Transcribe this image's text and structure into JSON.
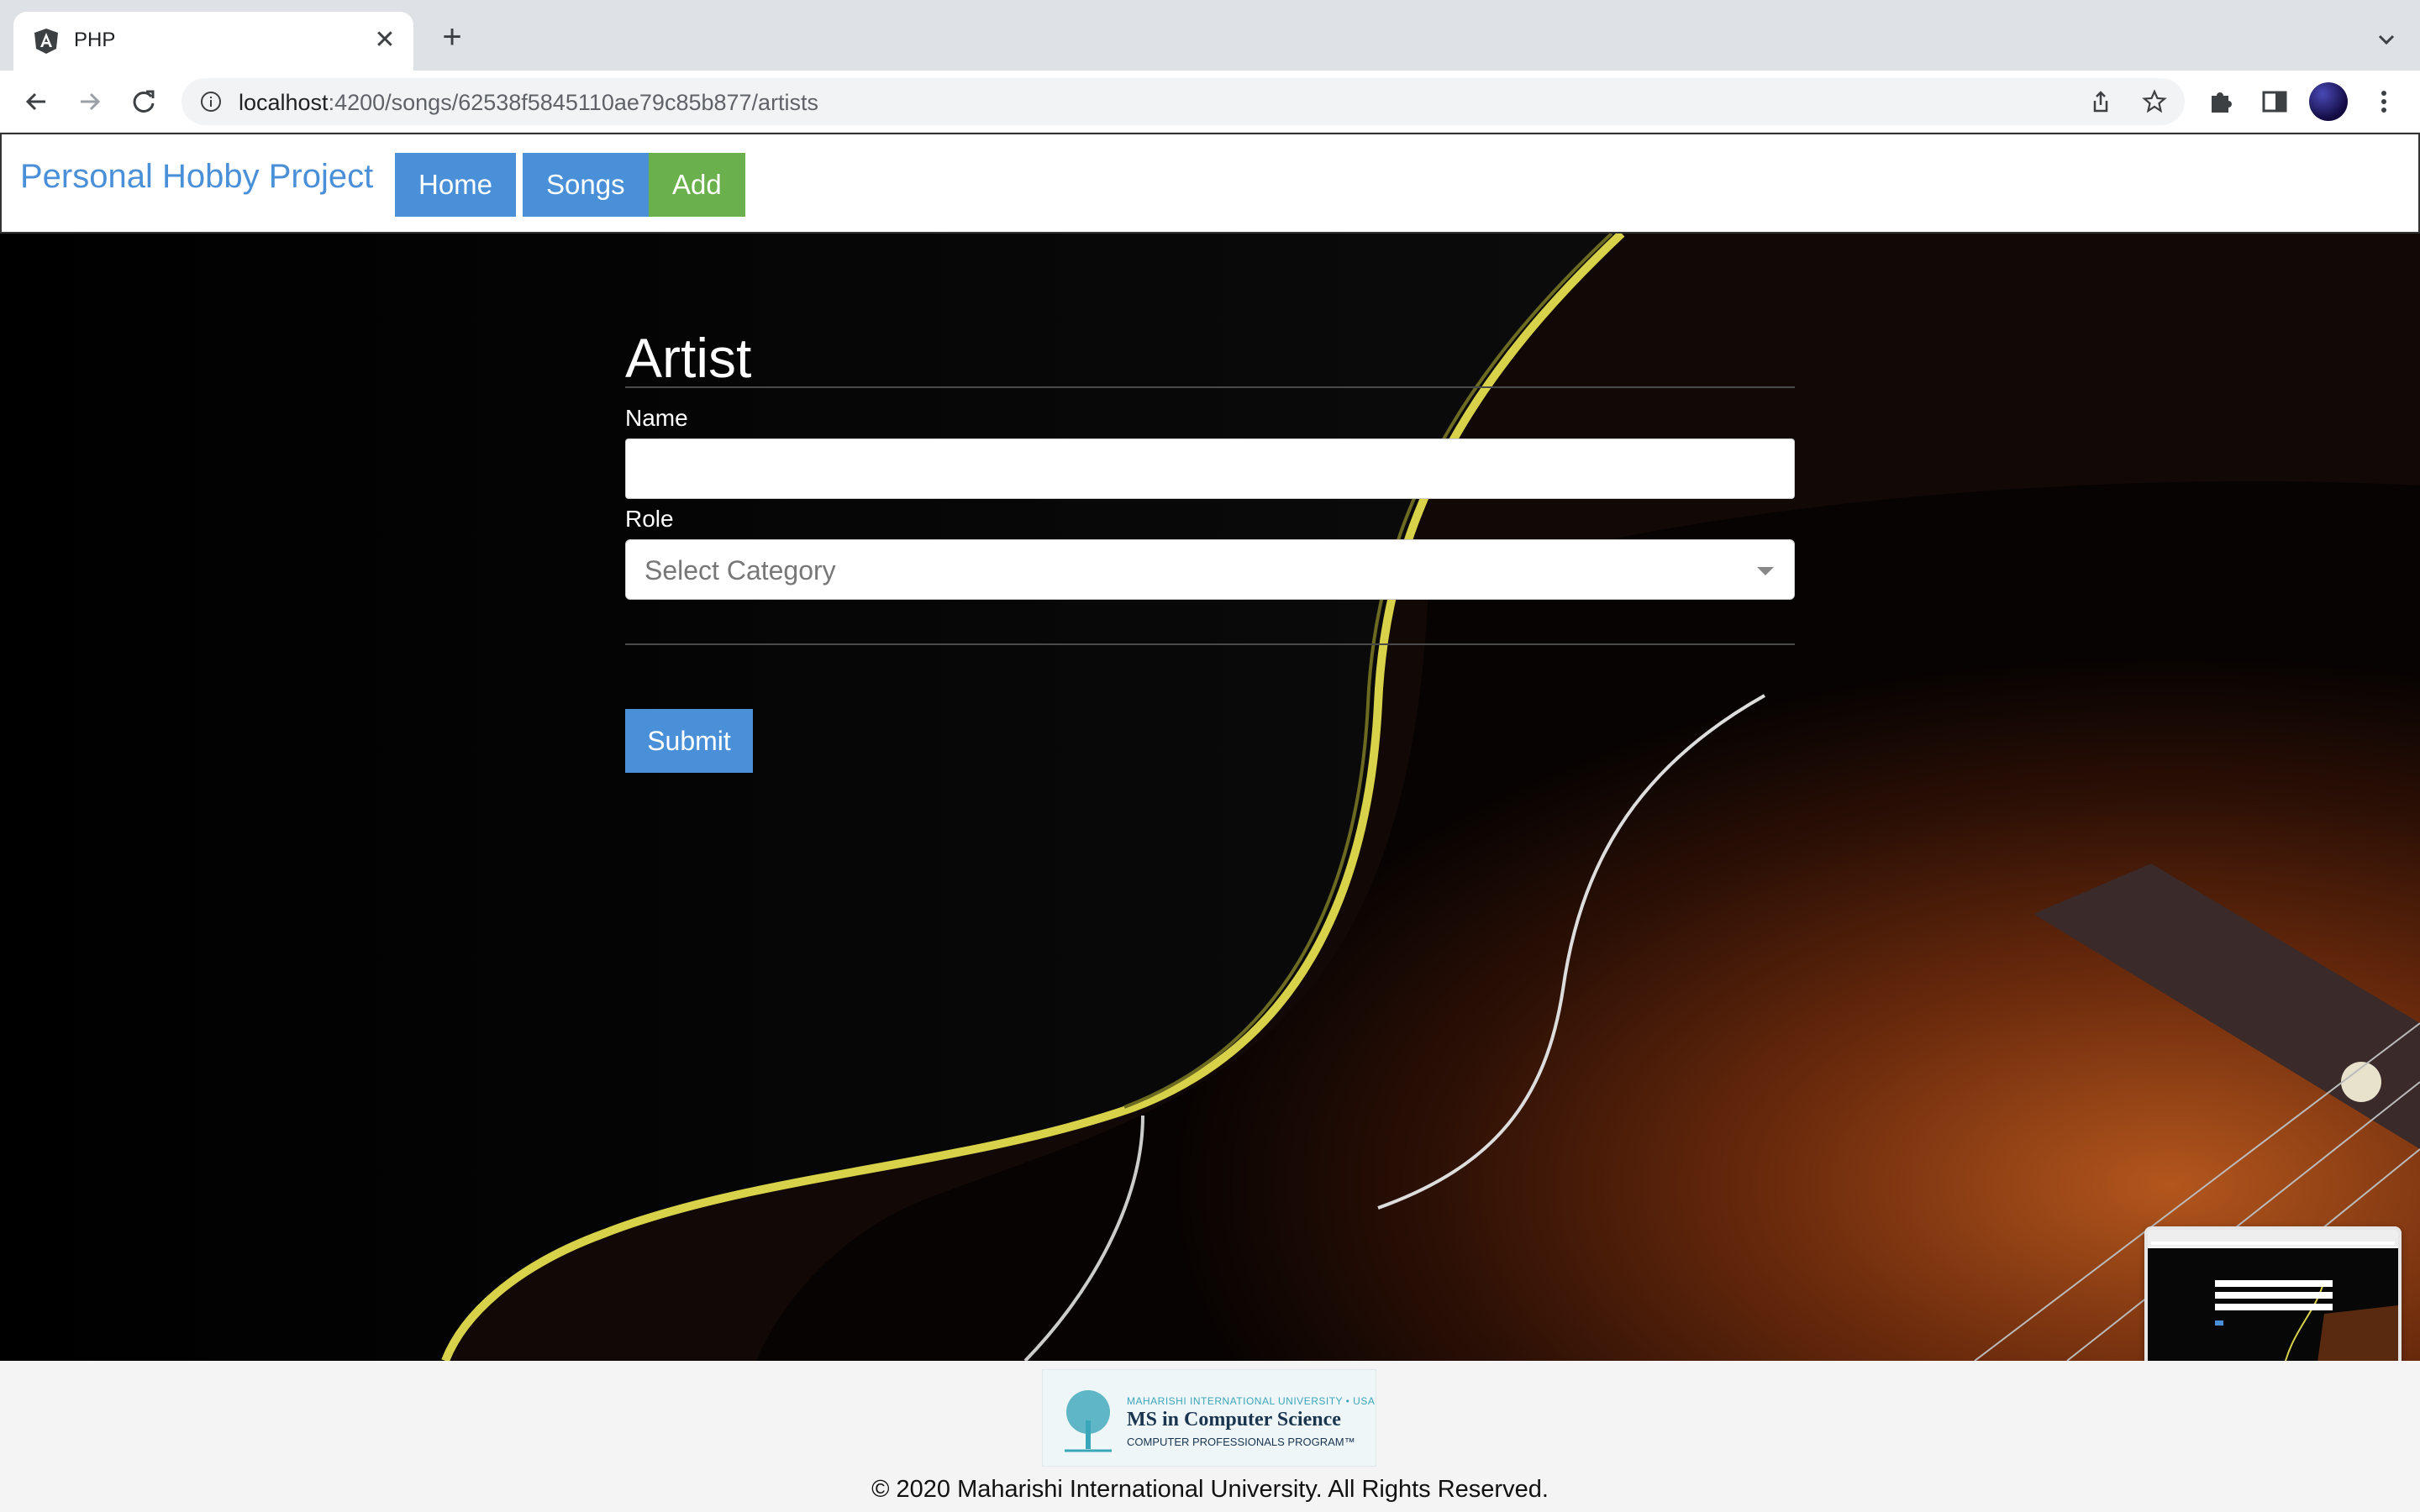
{
  "browser": {
    "tab_title": "PHP",
    "url_host": "localhost",
    "url_path": ":4200/songs/62538f5845110ae79c85b877/artists",
    "icons": [
      "angular-icon",
      "close-icon",
      "plus-icon",
      "chevron-down-icon",
      "back-icon",
      "forward-icon",
      "reload-icon",
      "info-icon",
      "share-icon",
      "star-icon",
      "extensions-icon",
      "side-panel-icon",
      "profile-avatar",
      "kebab-menu-icon"
    ]
  },
  "navbar": {
    "brand": "Personal Hobby Project",
    "links": [
      {
        "label": "Home",
        "color": "#4a90d9"
      },
      {
        "label": "Songs",
        "color": "#4a90d9"
      },
      {
        "label": "Add",
        "color": "#6ab04c"
      }
    ]
  },
  "form": {
    "title": "Artist",
    "name_label": "Name",
    "name_value": "",
    "role_label": "Role",
    "role_placeholder": "Select Category",
    "submit_label": "Submit"
  },
  "footer": {
    "logo": {
      "line1": "MAHARISHI INTERNATIONAL UNIVERSITY • USA",
      "line2": "MS in Computer Science",
      "line3": "COMPUTER PROFESSIONALS PROGRAM™"
    },
    "copyright": "© 2020 Maharishi International University. All Rights Reserved."
  }
}
